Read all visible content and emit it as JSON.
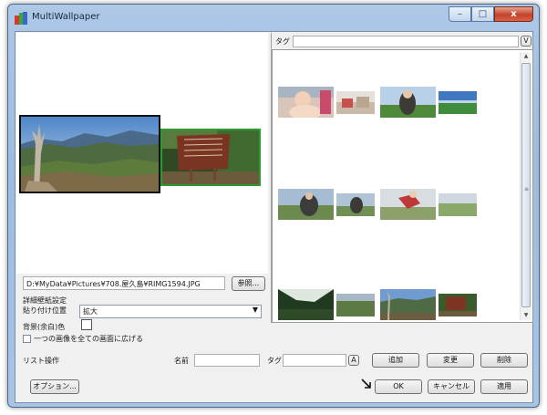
{
  "window": {
    "title": "MultiWallpaper"
  },
  "caption_buttons": {
    "minimize": "–",
    "maximize": "□",
    "close": "x"
  },
  "preview": {
    "current_path": "D:¥MyData¥Pictures¥708.屋久島¥RIMG1594.JPG",
    "browse_label": "参照..."
  },
  "settings": {
    "section_label": "詳細壁紙設定",
    "position_label": "貼り付け位置",
    "position_value": "拡大",
    "bg_color_label": "背景(余白)色",
    "stretch_all_label": "一つの画像を全ての画面に広げる"
  },
  "tag_filter": {
    "label": "タグ",
    "value": "",
    "toggle": "V"
  },
  "list_ops": {
    "label": "リスト操作",
    "name_label": "名前",
    "name_value": "",
    "tag_label": "タグ",
    "tag_value": "",
    "tag_toggle": "A",
    "add_label": "追加",
    "change_label": "変更",
    "delete_label": "削除"
  },
  "footer": {
    "options_label": "オプション...",
    "ok_label": "OK",
    "cancel_label": "キャンセル",
    "apply_label": "適用"
  }
}
